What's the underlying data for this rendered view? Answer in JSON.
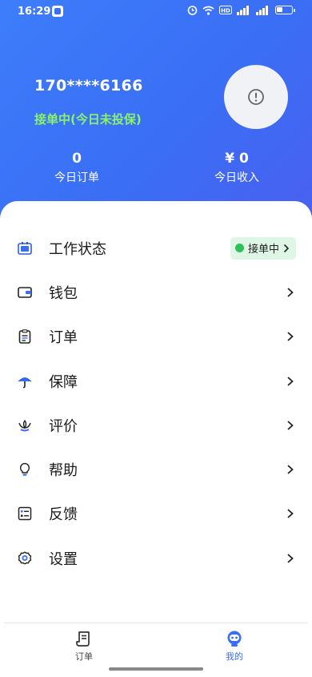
{
  "status_bar": {
    "time": "16:29",
    "icons": [
      "app-notification-icon",
      "alarm-icon",
      "wifi-icon",
      "hd-icon",
      "signal-icon",
      "signal-icon",
      "battery-icon"
    ]
  },
  "profile": {
    "phone": "170****6166",
    "work_status": "接单中(今日未投保)",
    "avatar_icon": "alert-circle-icon"
  },
  "stats": {
    "orders": {
      "value": "0",
      "label": "今日订单"
    },
    "income": {
      "value": "¥ 0",
      "label": "今日收入"
    }
  },
  "menu": {
    "items": [
      {
        "label": "工作状态",
        "icon": "work-status-icon",
        "badge": "接单中"
      },
      {
        "label": "钱包",
        "icon": "wallet-icon"
      },
      {
        "label": "订单",
        "icon": "clipboard-icon"
      },
      {
        "label": "保障",
        "icon": "umbrella-icon"
      },
      {
        "label": "评价",
        "icon": "lotus-icon"
      },
      {
        "label": "帮助",
        "icon": "lightbulb-icon"
      },
      {
        "label": "反馈",
        "icon": "feedback-icon"
      },
      {
        "label": "设置",
        "icon": "gear-icon"
      }
    ]
  },
  "tabbar": {
    "orders_label": "订单",
    "mine_label": "我的",
    "active": "我的"
  },
  "colors": {
    "brand": "#3a6ef5",
    "status_green": "#2ec05d",
    "status_text": "#8cf26a",
    "badge_bg": "#dff5e6"
  }
}
